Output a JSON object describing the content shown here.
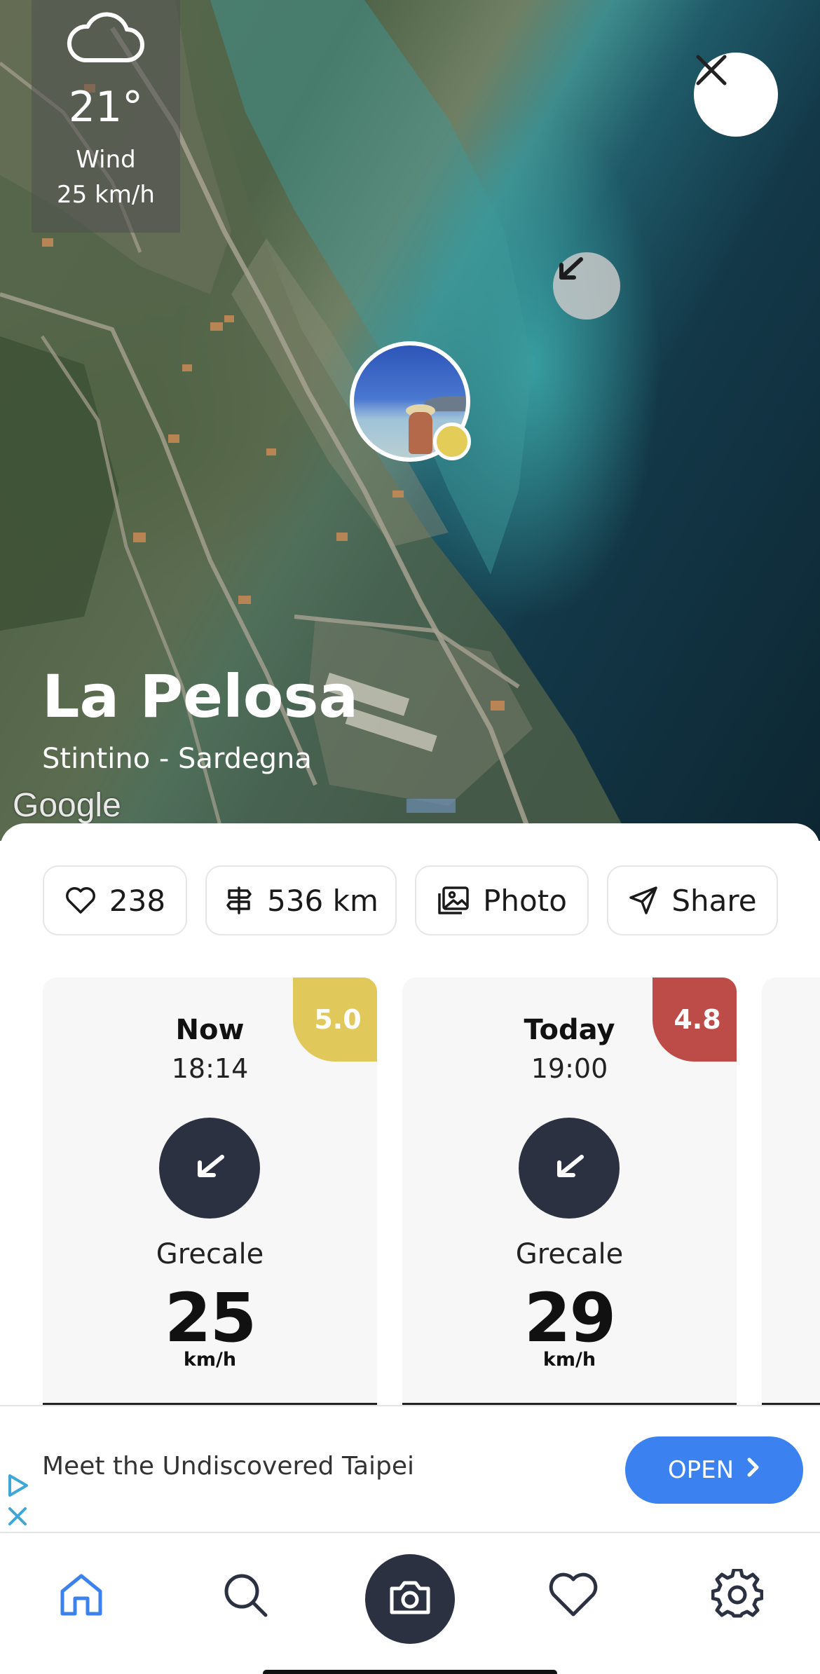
{
  "weather": {
    "icon": "cloud-icon",
    "temperature": "21°",
    "wind_label": "Wind",
    "wind_value": "25 km/h"
  },
  "place": {
    "name": "La Pelosa",
    "subtitle": "Stintino - Sardegna"
  },
  "map": {
    "provider_logo": "Google",
    "wind_arrow_icon": "arrow-down-left-icon"
  },
  "actions": {
    "likes": "238",
    "distance": "536 km",
    "photo_label": "Photo",
    "share_label": "Share"
  },
  "forecast": [
    {
      "label": "Now",
      "time": "18:14",
      "score": "5.0",
      "score_color": "#e0c95a",
      "direction": "Grecale",
      "speed": "25",
      "unit": "km/h"
    },
    {
      "label": "Today",
      "time": "19:00",
      "score": "4.8",
      "score_color": "#bd4b48",
      "direction": "Grecale",
      "speed": "29",
      "unit": "km/h"
    }
  ],
  "ad": {
    "text": "Meet the Undiscovered Taipei",
    "button_label": "OPEN",
    "accent": "#3b82f0"
  },
  "nav": {
    "items": [
      "home-icon",
      "search-icon",
      "camera-icon",
      "heart-icon",
      "settings-icon"
    ],
    "active_color": "#3b82f0",
    "dark_color": "#2c3142"
  }
}
